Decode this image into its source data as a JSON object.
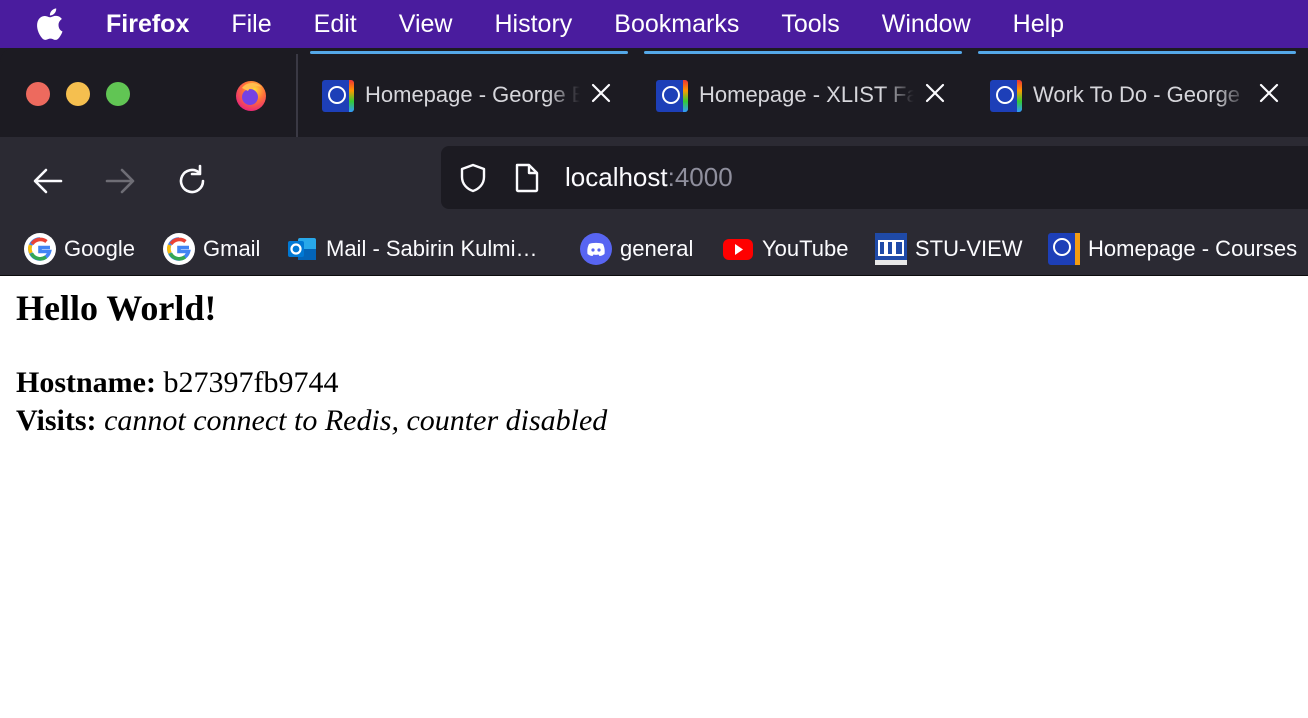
{
  "menubar": {
    "app_name": "Firefox",
    "items": [
      "File",
      "Edit",
      "View",
      "History",
      "Bookmarks",
      "Tools",
      "Window",
      "Help"
    ]
  },
  "tabs": [
    {
      "title": "Homepage - George Brown College",
      "icon": "gbc-favicon"
    },
    {
      "title": "Homepage - XLIST Fall",
      "icon": "gbc-favicon"
    },
    {
      "title": "Work To Do - George Brown",
      "icon": "gbc-favicon"
    }
  ],
  "urlbar": {
    "host": "localhost",
    "port": ":4000"
  },
  "bookmarks": [
    {
      "label": "Google",
      "icon": "google-icon"
    },
    {
      "label": "Gmail",
      "icon": "google-icon"
    },
    {
      "label": "Mail - Sabirin Kulmi…",
      "icon": "outlook-icon"
    },
    {
      "label": "general",
      "icon": "discord-icon"
    },
    {
      "label": "YouTube",
      "icon": "youtube-icon"
    },
    {
      "label": "STU-VIEW",
      "icon": "gbc-icon"
    },
    {
      "label": "Homepage - Courses",
      "icon": "gbc-favicon"
    }
  ],
  "page": {
    "heading": "Hello World!",
    "hostname_label": "Hostname:",
    "hostname_value": "b27397fb9744",
    "visits_label": "Visits:",
    "visits_value": "cannot connect to Redis, counter disabled"
  },
  "colors": {
    "menubar_bg": "#4a1c9e",
    "tabstrip_bg": "#1c1b22",
    "toolbar_bg": "#2b2a33",
    "tab_accent": "#54a8e8"
  }
}
